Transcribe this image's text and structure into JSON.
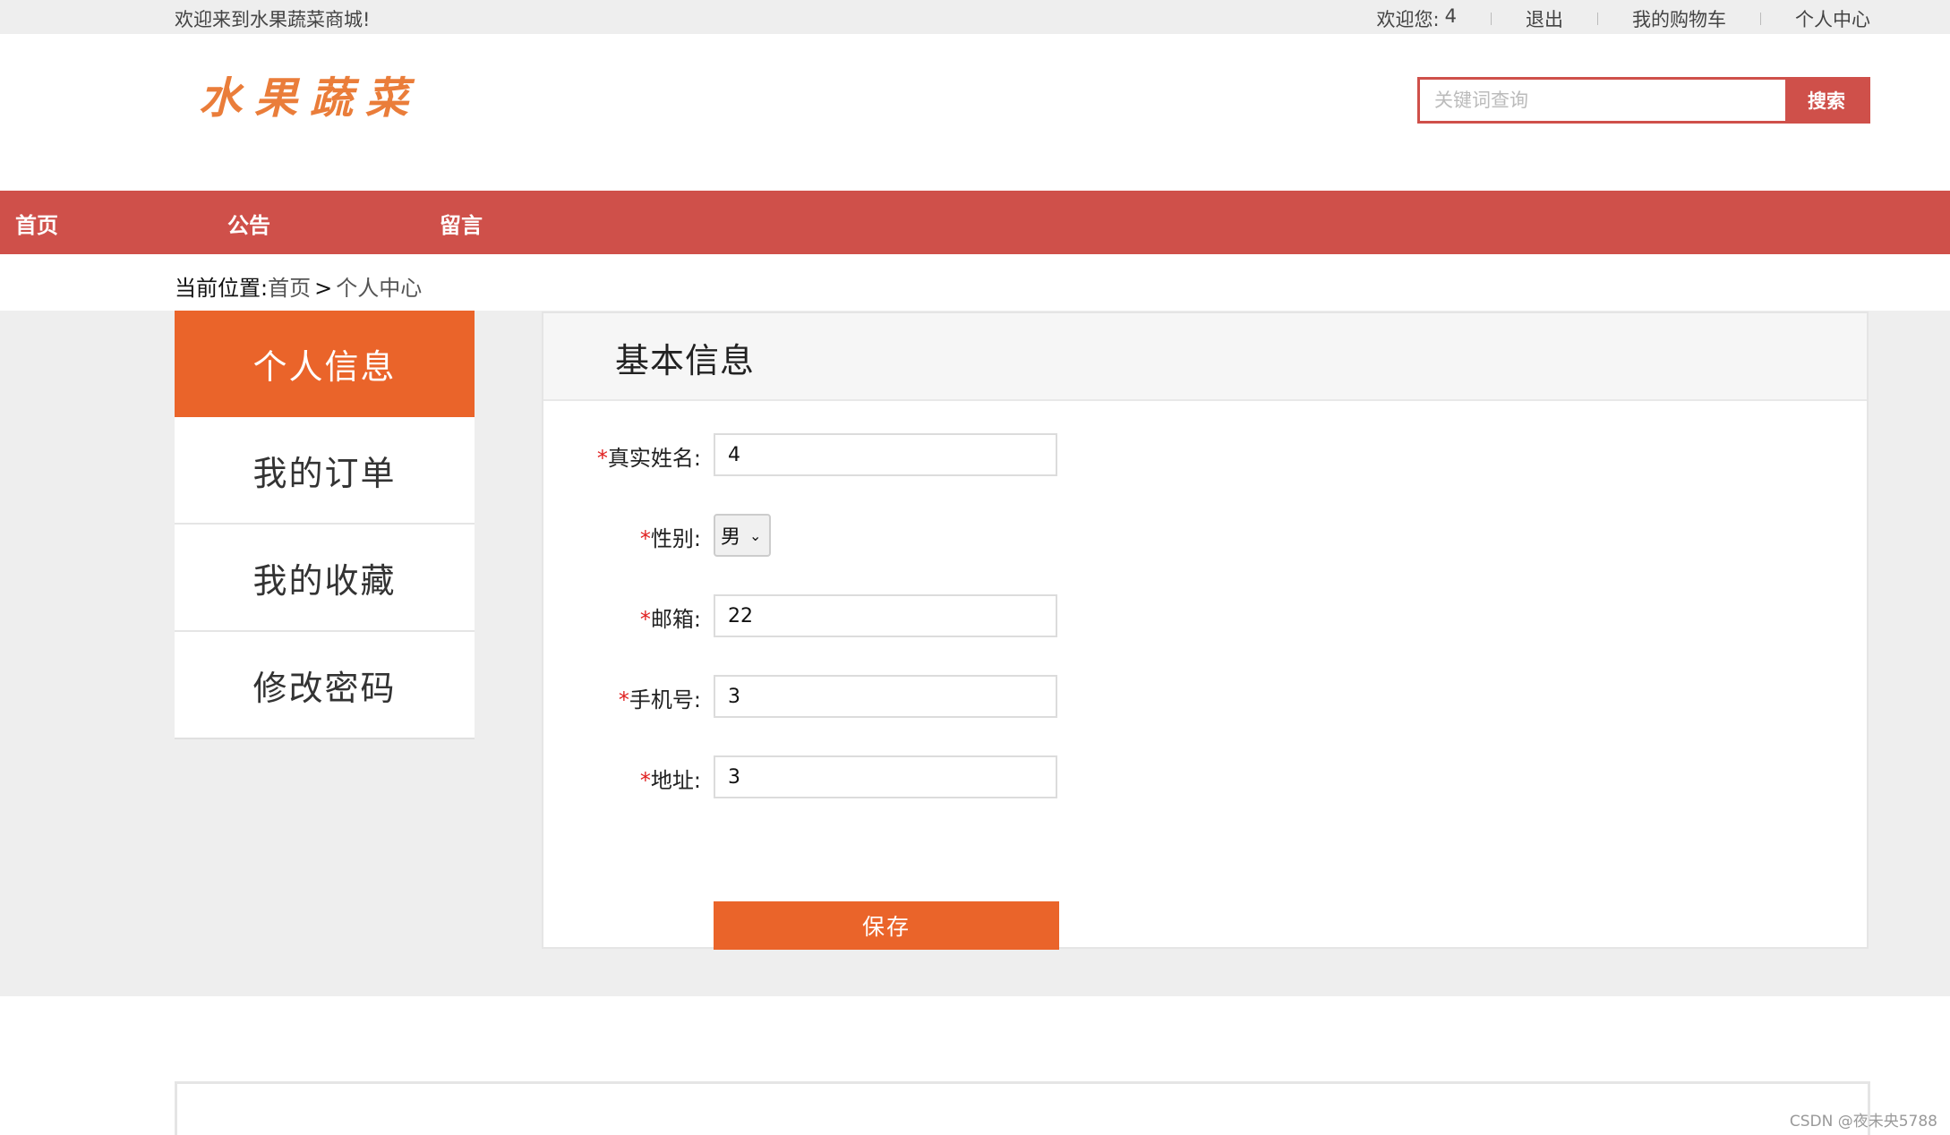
{
  "topbar": {
    "welcome": "欢迎来到水果蔬菜商城!",
    "user_label": "欢迎您:",
    "username": "4",
    "logout": "退出",
    "cart": "我的购物车",
    "profile": "个人中心"
  },
  "header": {
    "logo_text": "水果蔬菜",
    "search": {
      "placeholder": "关键词查询",
      "button": "搜索"
    }
  },
  "nav": [
    {
      "label": "首页"
    },
    {
      "label": "公告"
    },
    {
      "label": "留言"
    }
  ],
  "breadcrumb": {
    "label": "当前位置:",
    "home": "首页",
    "separator": ">",
    "current": "个人中心"
  },
  "sidebar": {
    "items": [
      {
        "label": "个人信息",
        "active": true
      },
      {
        "label": "我的订单"
      },
      {
        "label": "我的收藏"
      },
      {
        "label": "修改密码"
      }
    ]
  },
  "panel": {
    "title": "基本信息",
    "fields": {
      "realname": {
        "label": "真实姓名:",
        "value": "4"
      },
      "gender": {
        "label": "性别:",
        "value": "男"
      },
      "email": {
        "label": "邮箱:",
        "value": "22"
      },
      "phone": {
        "label": "手机号:",
        "value": "3"
      },
      "address": {
        "label": "地址:",
        "value": "3"
      }
    },
    "required_mark": "*",
    "save_label": "保存"
  },
  "watermark": "CSDN @夜未央5788",
  "colors": {
    "brand_red": "#cf504a",
    "accent_orange": "#ea642a",
    "logo_orange": "#ea7d3a"
  }
}
